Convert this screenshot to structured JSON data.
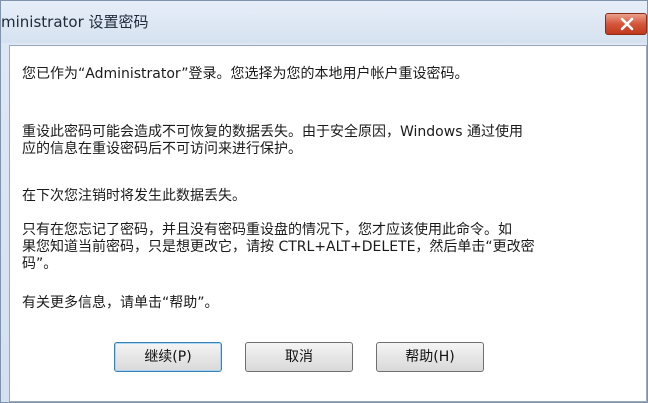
{
  "window": {
    "title": "ministrator 设置密码"
  },
  "message": {
    "line1": "您已作为“Administrator”登录。您选择为您的本地用户帐户重设密码。",
    "para2_line1": "重设此密码可能会造成不可恢复的数据丢失。由于安全原因，Windows 通过使用",
    "para2_line2": "应的信息在重设密码后不可访问来进行保护。",
    "para3": "在下次您注销时将发生此数据丢失。",
    "para4_line1": "只有在您忘记了密码，并且没有密码重设盘的情况下，您才应该使用此命令。如",
    "para4_line2": "果您知道当前密码，只是想更改它，请按 CTRL+ALT+DELETE，然后单击“更改密",
    "para4_line3": "码”。",
    "para5": "有关更多信息，请单击“帮助”。"
  },
  "buttons": {
    "continue_label": "继续(P)",
    "cancel_label": "取消",
    "help_label": "帮助(H)"
  },
  "icons": {
    "close": "close-icon"
  },
  "colors": {
    "close_button": "#c0391d",
    "default_button_border": "#3c7fb1"
  }
}
